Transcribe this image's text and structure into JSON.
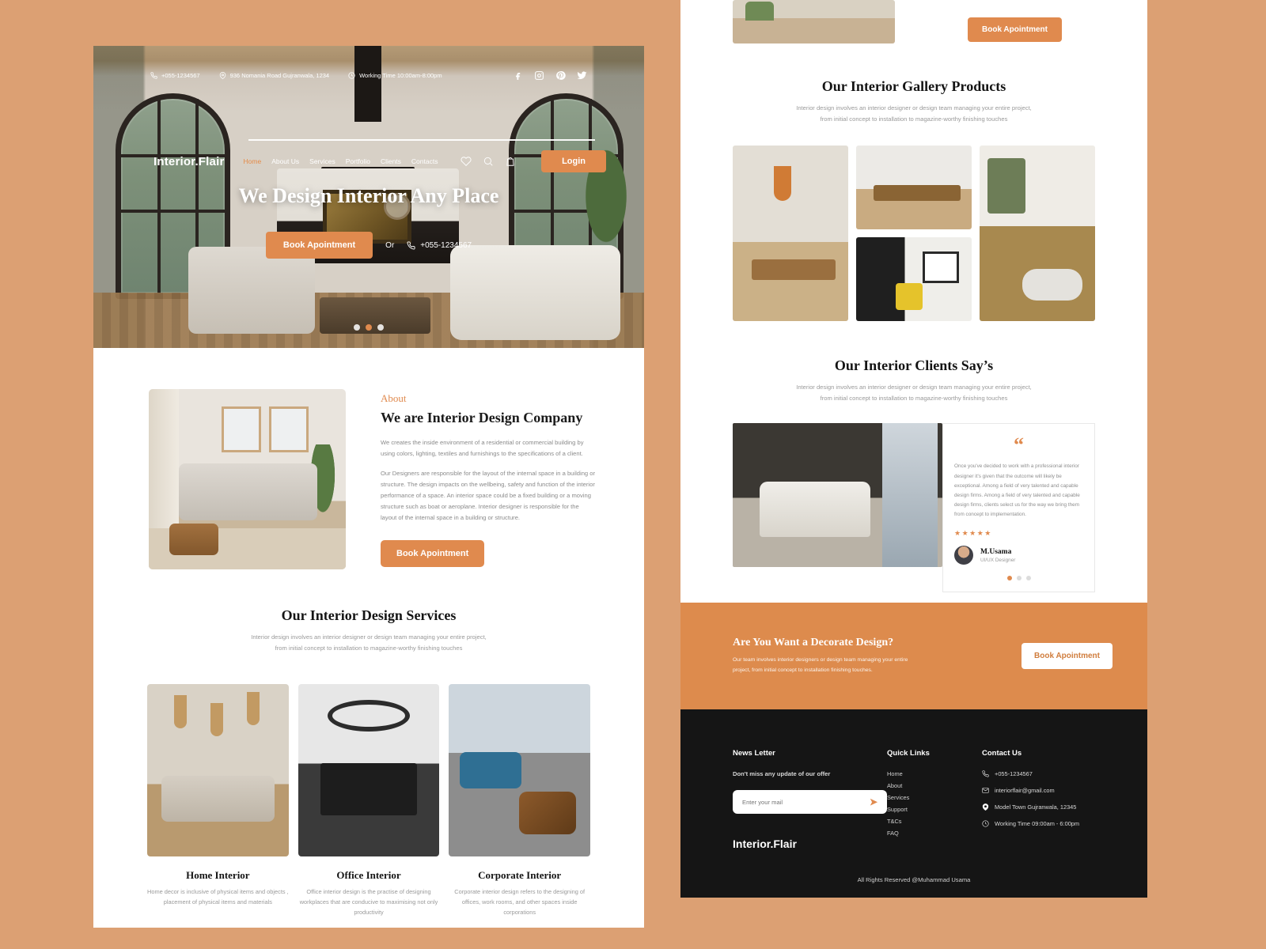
{
  "brand": "Interior.Flair",
  "topbar": {
    "phone": "+055-1234567",
    "address": "936 Nomania Road Gujranwala, 1234",
    "hours": "Working Time 10:00am-8:00pm",
    "socials": [
      "facebook-icon",
      "instagram-icon",
      "pinterest-icon",
      "twitter-icon"
    ]
  },
  "nav": {
    "links": [
      {
        "label": "Home",
        "active": true
      },
      {
        "label": "About Us",
        "active": false
      },
      {
        "label": "Services",
        "active": false
      },
      {
        "label": "Portfolio",
        "active": false
      },
      {
        "label": "Clients",
        "active": false
      },
      {
        "label": "Contacts",
        "active": false
      }
    ],
    "icons": [
      "heart-icon",
      "search-icon",
      "bag-icon"
    ],
    "login_label": "Login"
  },
  "hero": {
    "title": "We Design Interior Any Place",
    "book_label": "Book Apointment",
    "or_label": "Or",
    "phone": "+055-1234567",
    "slides": 3,
    "active_slide": 2
  },
  "about": {
    "kicker": "About",
    "heading": "We are Interior Design Company",
    "paragraph1": "We creates the inside environment of a residential or commercial building by using colors, lighting, textiles and furnishings to the specifications of a client.",
    "paragraph2": "Our Designers are responsible for the layout of the internal space in a building or structure. The design impacts on the wellbeing, safety and function of the interior performance of a space. An interior space could be a fixed building or a moving structure such as boat or aeroplane. Interior designer is responsible for the layout of the internal space in a building or structure.",
    "button_label": "Book Apointment"
  },
  "services": {
    "title": "Our Interior Design Services",
    "subtitle": "Interior design involves an interior designer or design team managing your entire project, from initial concept to installation to magazine-worthy finishing touches",
    "cards": [
      {
        "title": "Home Interior",
        "desc": "Home decor is inclusive of physical items and objects , placement of physical items and materials"
      },
      {
        "title": "Office Interior",
        "desc": "Office interior design is the practise of designing workplaces that are conducive to maximising not only productivity"
      },
      {
        "title": "Corporate Interior",
        "desc": "Corporate interior design refers to the designing of offices, work rooms, and other spaces inside corporations"
      }
    ]
  },
  "fragment": {
    "book_label": "Book Apointment"
  },
  "gallery": {
    "title": "Our Interior Gallery Products",
    "subtitle": "Interior design involves an interior designer or design team managing your entire project, from initial concept to installation to magazine-worthy finishing touches"
  },
  "clients": {
    "title": "Our Interior Clients Say’s",
    "subtitle": "Interior design involves an interior designer or design team managing your entire project, from initial concept to installation to magazine-worthy finishing touches",
    "quote_mark": "“",
    "testimonial": "Once you've decided to work with a professional interior designer it's given that the outcome will likely be exceptional. Among a field of very talented and capable design firms. Among a field of very talented and capable design firms, clients select us for the way we bring them from concept to implementation.",
    "stars": "★★★★★",
    "name": "M.Usama",
    "role": "UI/UX Designer",
    "dots": 3,
    "active_dot": 1
  },
  "cta": {
    "title": "Are You Want  a Decorate Design?",
    "subtitle": "Our team involves interior designers or design team managing your entire project, from initial concept to installation finishing touches.",
    "button_label": "Book Apointment"
  },
  "footer": {
    "news_heading": "News Letter",
    "news_sub": "Don't miss any update of our offer",
    "news_placeholder": "Enter your mail",
    "send_icon": "➤",
    "brand": "Interior.Flair",
    "quick_heading": "Quick Links",
    "quick_links": [
      "Home",
      "About",
      "Services",
      "Support",
      "T&Cs",
      "FAQ"
    ],
    "contact_heading": "Contact Us",
    "contact": [
      {
        "icon": "phone-icon",
        "text": "+055-1234567"
      },
      {
        "icon": "mail-icon",
        "text": "interiorflair@gmail.com"
      },
      {
        "icon": "location-icon",
        "text": "Model Town Gujranwala, 12345"
      },
      {
        "icon": "clock-icon",
        "text": "Working Time 09:00am - 6:00pm"
      }
    ],
    "copyright": "All Rights Reserved @Muhammad Usama"
  },
  "colors": {
    "accent": "#e08a4e",
    "page_bg": "#dca073",
    "footer_bg": "#151515",
    "cta_bg": "#dd8b4d"
  }
}
